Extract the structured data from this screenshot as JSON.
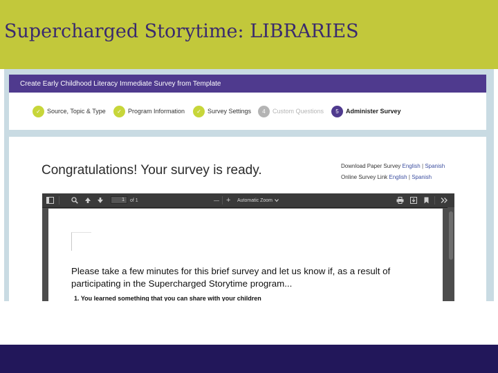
{
  "slide": {
    "title": "Supercharged Storytime: LIBRARIES"
  },
  "wizard": {
    "header": "Create Early Childhood Literacy Immediate Survey from Template",
    "steps": [
      {
        "marker": "✓",
        "label": "Source, Topic & Type",
        "state": "done"
      },
      {
        "marker": "✓",
        "label": "Program Information",
        "state": "done"
      },
      {
        "marker": "✓",
        "label": "Survey Settings",
        "state": "done"
      },
      {
        "marker": "4",
        "label": "Custom Questions",
        "state": "todo"
      },
      {
        "marker": "5",
        "label": "Administer Survey",
        "state": "active"
      }
    ]
  },
  "main": {
    "heading": "Congratulations! Your survey is ready.",
    "download": {
      "label": "Download Paper Survey",
      "english": "English",
      "separator": "|",
      "spanish": "Spanish"
    },
    "online": {
      "label": "Online Survey Link",
      "english": "English",
      "separator": "|",
      "spanish": "Spanish"
    }
  },
  "pdf_viewer": {
    "page_number": "1",
    "page_total": "of 1",
    "zoom": "Automatic Zoom",
    "zoom_out": "—",
    "zoom_in": "+",
    "page_text": "Please take a few minutes for this brief survey and let us know if, as a result of participating in the Supercharged Storytime program...",
    "first_item": "1.  You learned something that you can share with your children"
  },
  "colors": {
    "header_band": "#c2c83b",
    "title_text": "#3a2a6e",
    "wizard_bar": "#4f3a8e",
    "step_done": "#c7d63a",
    "footer_band": "#22175a"
  }
}
